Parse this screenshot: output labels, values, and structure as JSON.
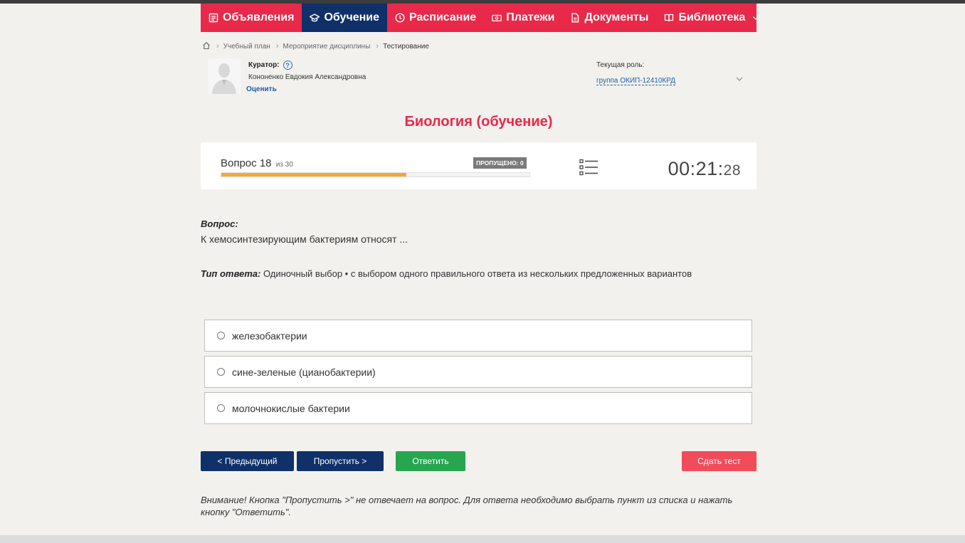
{
  "nav": {
    "items": [
      {
        "label": "Объявления",
        "icon": "announcements-icon"
      },
      {
        "label": "Обучение",
        "icon": "graduation-cap-icon",
        "active": true
      },
      {
        "label": "Расписание",
        "icon": "clock-icon"
      },
      {
        "label": "Платежи",
        "icon": "payment-icon"
      },
      {
        "label": "Документы",
        "icon": "document-icon"
      },
      {
        "label": "Библиотека",
        "icon": "book-icon"
      }
    ]
  },
  "breadcrumb": {
    "items": [
      "Учебный план",
      "Мероприятие дисциплины",
      "Тестирование"
    ]
  },
  "curator": {
    "title": "Куратор:",
    "name": "Кононенко Евдокия Александровна",
    "rate_label": "Оценить"
  },
  "role": {
    "label": "Текущая роль:",
    "value": "группа ОКИП-12410КРД"
  },
  "page_title": "Биология (обучение)",
  "progress": {
    "question_prefix": "Вопрос",
    "current": "18",
    "total_text": "из 30",
    "current_num": 18,
    "total_num": 30,
    "skipped_text": "ПРОПУЩЕНО: 0",
    "timer_main": "00:21:",
    "timer_seconds": "28"
  },
  "question": {
    "label": "Вопрос:",
    "text": "К хемосинтезирующим бактериям относят ...",
    "answer_type_label": "Тип ответа:",
    "answer_type_text": "Одиночный выбор • с выбором одного правильного ответа из нескольких предложенных вариантов"
  },
  "options": [
    "железобактерии",
    "сине-зеленые (цианобактерии)",
    "молочнокислые бактерии"
  ],
  "buttons": {
    "prev": "< Предыдущий",
    "skip": "Пропустить >",
    "answer": "Ответить",
    "finish": "Сдать тест"
  },
  "warning": "Внимание! Кнопка \"Пропустить >\" не отвечает на вопрос. Для ответа необходимо выбрать пункт из списка и нажать кнопку \"Ответить\".",
  "colors": {
    "nav_bg": "#e8294a",
    "nav_active": "#0f3068",
    "progress_fill": "#f0a93a",
    "answer_button": "#27a550",
    "finish_button": "#f24b5a"
  }
}
